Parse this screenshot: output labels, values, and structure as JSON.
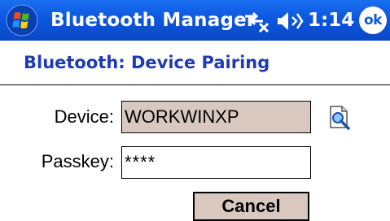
{
  "titlebar": {
    "start_icon": "windows-flag-icon",
    "title": "Bluetooth Manager",
    "connectivity_icon": "connectivity-icon",
    "volume_icon": "speaker-volume-icon",
    "time": "1:14",
    "ok_label": "ok"
  },
  "page": {
    "heading": "Bluetooth: Device Pairing"
  },
  "form": {
    "device_label": "Device:",
    "device_value": "WORKWINXP",
    "browse_icon": "browse-device-icon",
    "passkey_label": "Passkey:",
    "passkey_value": "****",
    "cancel_label": "Cancel"
  },
  "colors": {
    "titlebar_blue": "#0c57df",
    "heading_blue": "#1f3bb4",
    "readonly_field_bg": "#d8c8c0"
  }
}
